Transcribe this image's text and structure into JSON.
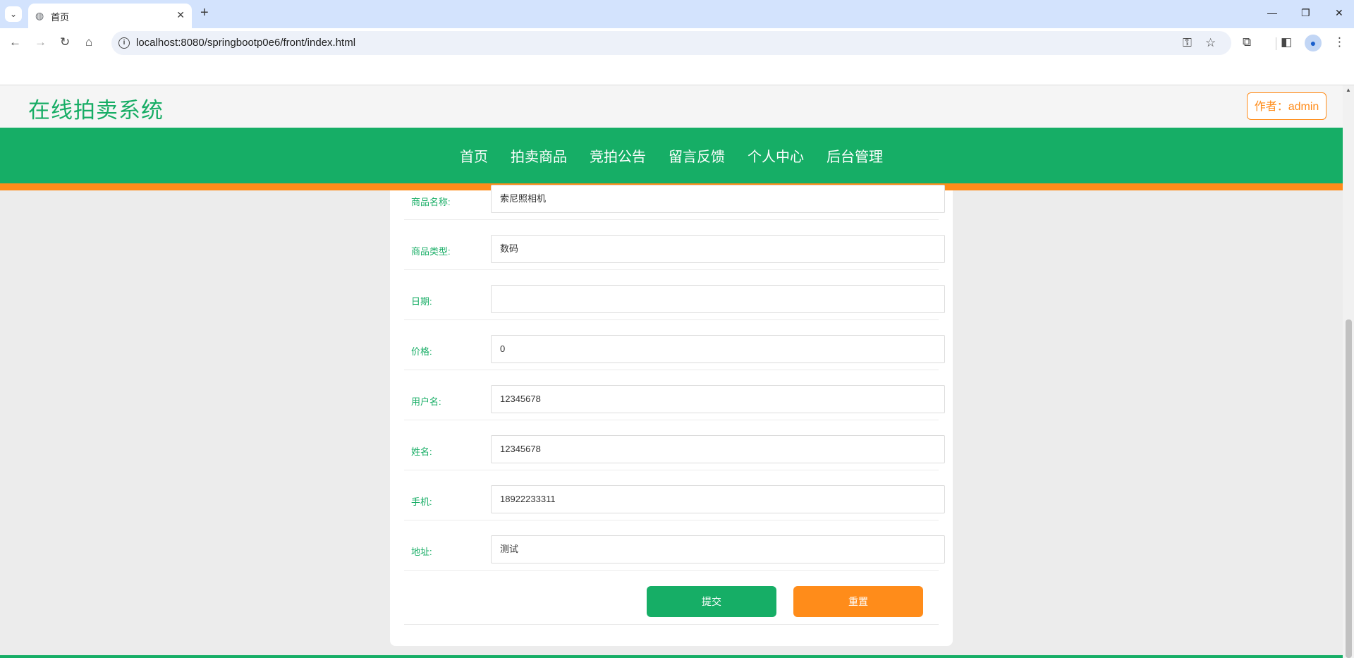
{
  "browser": {
    "tab_title": "首页",
    "url": "localhost:8080/springbootp0e6/front/index.html"
  },
  "site": {
    "title": "在线拍卖系统",
    "author": "作者：admin"
  },
  "nav": {
    "items": [
      "首页",
      "拍卖商品",
      "竞拍公告",
      "留言反馈",
      "个人中心",
      "后台管理"
    ]
  },
  "form": {
    "fields": [
      {
        "label": "商品名称:",
        "value": "索尼照相机"
      },
      {
        "label": "商品类型:",
        "value": "数码"
      },
      {
        "label": "日期:",
        "value": ""
      },
      {
        "label": "价格:",
        "value": "0"
      },
      {
        "label": "用户名:",
        "value": "12345678"
      },
      {
        "label": "姓名:",
        "value": "12345678"
      },
      {
        "label": "手机:",
        "value": "18922233311"
      },
      {
        "label": "地址:",
        "value": "测试"
      }
    ],
    "submit_label": "提交",
    "reset_label": "重置"
  },
  "colors": {
    "brand_green": "#16ae66",
    "accent_orange": "#ff8c1a"
  },
  "icons": [
    "globe-icon",
    "close-icon",
    "plus-icon",
    "back-icon",
    "forward-icon",
    "reload-icon",
    "home-icon",
    "info-icon",
    "key-icon",
    "star-icon",
    "extensions-icon",
    "sidepanel-icon",
    "profile-icon",
    "menu-icon"
  ]
}
